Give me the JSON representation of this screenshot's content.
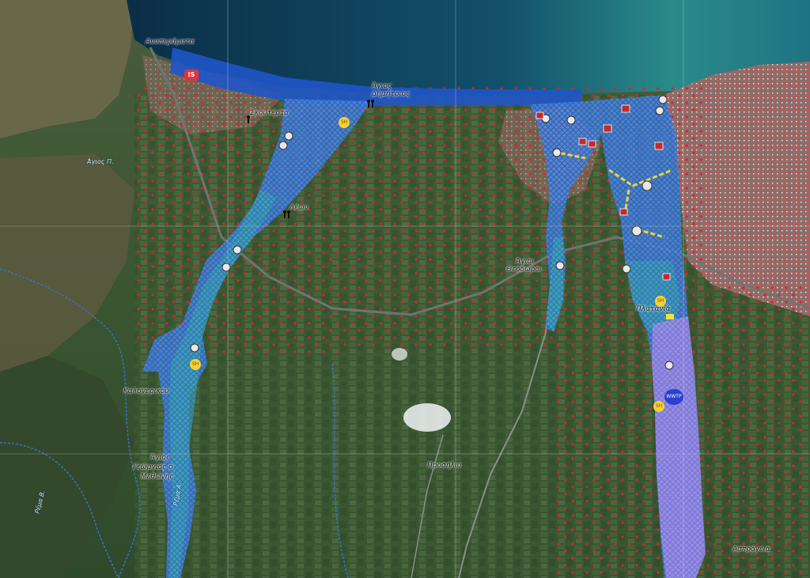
{
  "map": {
    "place_labels": [
      {
        "id": "label-anopetraamata",
        "text": "Ανοπεράματα"
      },
      {
        "id": "label-agios-dimitrios-1",
        "text": "Άγιος"
      },
      {
        "id": "label-agios-dimitrios-2",
        "text": "Δημήτριος"
      },
      {
        "id": "label-skouterta",
        "text": "Σκουτέρτα"
      },
      {
        "id": "label-mid-village",
        "text": "Λέων"
      },
      {
        "id": "label-agios-theodoroi-1",
        "text": "Άγιοι"
      },
      {
        "id": "label-agios-theodoroi-2",
        "text": "Θεόδωροι"
      },
      {
        "id": "label-platania",
        "text": "Πλατανιά"
      },
      {
        "id": "label-kalogerikou",
        "text": "Καλογερικού"
      },
      {
        "id": "label-agios-1",
        "text": "Άγιος"
      },
      {
        "id": "label-agios-2",
        "text": "Γεώργιος ο"
      },
      {
        "id": "label-agios-3",
        "text": "Μεθώνης"
      },
      {
        "id": "label-prosilio",
        "text": "Προσήλιο"
      },
      {
        "id": "label-asprogeia",
        "text": "Ασπρόγεια"
      }
    ],
    "river_labels": [
      {
        "id": "river-label-1",
        "text": "Άγιος Π."
      },
      {
        "id": "river-label-2",
        "text": "Ρέμα Α."
      },
      {
        "id": "river-label-3",
        "text": "Ρέμα Β."
      }
    ],
    "symbols": {
      "is_badge": "IS",
      "sh_badge": "SH",
      "wwtp_badge": "WWTP"
    },
    "colors": {
      "sea_deep": "#0c3550",
      "sea_shallow": "#2d8a8c",
      "land": "#3b5a33",
      "flood_blue": "#4a86e0",
      "flood_purple": "#9a86e6",
      "flood_green": "#2fa38a",
      "coast_band": "#1f55c8",
      "points": "#e0202a"
    }
  }
}
